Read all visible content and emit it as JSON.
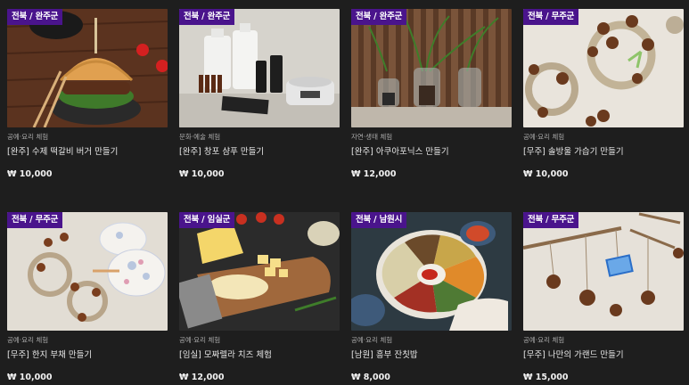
{
  "products": [
    {
      "region": "전북 / 완주군",
      "category": "공예·요리 체험",
      "title": "[완주] 수제 떡갈비 버거 만들기",
      "price": "₩ 10,000",
      "image": "burger-photo"
    },
    {
      "region": "전북 / 완주군",
      "category": "문화·예술 체험",
      "title": "[완주] 창포 샴푸 만들기",
      "price": "₩ 10,000",
      "image": "shampoo-kit-photo"
    },
    {
      "region": "전북 / 완주군",
      "category": "자연·생태 체험",
      "title": "[완주] 아쿠아포닉스 만들기",
      "price": "₩ 12,000",
      "image": "aquaponics-photo"
    },
    {
      "region": "전북 / 무주군",
      "category": "공예·요리 체험",
      "title": "[무주] 솔방울 가습기 만들기",
      "price": "₩ 10,000",
      "image": "pinecone-wreath-photo"
    },
    {
      "region": "전북 / 무주군",
      "category": "공예·요리 체험",
      "title": "[무주] 한지 부채 만들기",
      "price": "₩ 10,000",
      "image": "hanji-fan-photo"
    },
    {
      "region": "전북 / 임실군",
      "category": "공예·요리 체험",
      "title": "[임실] 모짜렐라 치즈 체험",
      "price": "₩ 12,000",
      "image": "cheese-photo"
    },
    {
      "region": "전북 / 남원시",
      "category": "공예·요리 체험",
      "title": "[남원] 흥부 잔칫밥",
      "price": "₩ 8,000",
      "image": "feast-photo"
    },
    {
      "region": "전북 / 무주군",
      "category": "공예·요리 체험",
      "title": "[무주] 나만의 가랜드 만들기",
      "price": "₩ 15,000",
      "image": "garland-photo"
    }
  ],
  "colors": {
    "badge": "#4a148c",
    "background": "#1e1e1e"
  }
}
